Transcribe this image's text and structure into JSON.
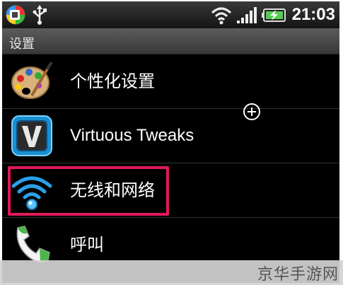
{
  "status_bar": {
    "time": "21:03",
    "icons": [
      "notification-app-icon",
      "usb-icon",
      "wifi-icon",
      "signal-bars-icon",
      "battery-charging-icon"
    ]
  },
  "header": {
    "title": "设置"
  },
  "settings_items": [
    {
      "label": "个性化设置",
      "icon": "palette-icon"
    },
    {
      "label": "Virtuous Tweaks",
      "icon": "virtuous-v-icon"
    },
    {
      "label": "无线和网络",
      "icon": "wireless-icon"
    },
    {
      "label": "呼叫",
      "icon": "phone-icon"
    }
  ],
  "highlighted_item": "无线和网络",
  "accent_colors": {
    "highlight_border": "#e0195a",
    "wifi_blue": "#2aa0e8"
  },
  "watermark": "京华手游网"
}
